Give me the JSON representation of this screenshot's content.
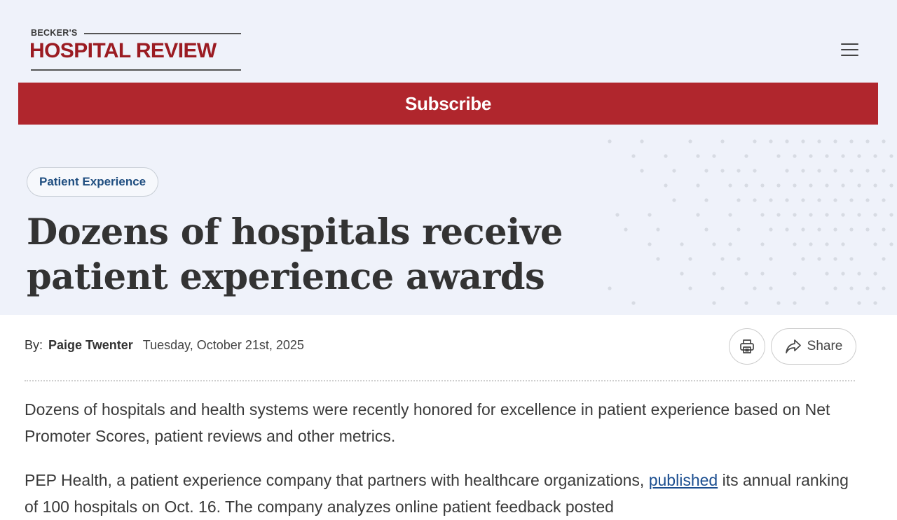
{
  "header": {
    "logo_small": "BECKER'S",
    "logo_main": "HOSPITAL REVIEW",
    "menu_icon": "hamburger-menu-icon"
  },
  "subscribe": {
    "label": "Subscribe"
  },
  "article": {
    "category_tag": "Patient Experience",
    "headline": "Dozens of hospitals receive patient experience awards",
    "byline": {
      "prefix": "By:",
      "author": "Paige Twenter",
      "date": "Tuesday, October 21st, 2025"
    },
    "actions": {
      "print_icon": "printer-icon",
      "share_icon": "share-arrow-icon",
      "share_label": "Share"
    },
    "paragraphs": {
      "p1": "Dozens of hospitals and health systems were recently honored for excellence in patient experience based on Net Promoter Scores, patient reviews and other metrics.",
      "p2_before": "PEP Health, a patient experience company that partners with healthcare organizations, ",
      "p2_link": "published",
      "p2_after": " its annual ranking of 100 hospitals on Oct. 16. The company analyzes online patient feedback posted"
    }
  },
  "colors": {
    "brand_red": "#b0262d",
    "logo_red": "#9b1b22",
    "hero_background": "#eff2fa",
    "link_blue": "#1a4d8f",
    "tag_text": "#1f4e80"
  }
}
